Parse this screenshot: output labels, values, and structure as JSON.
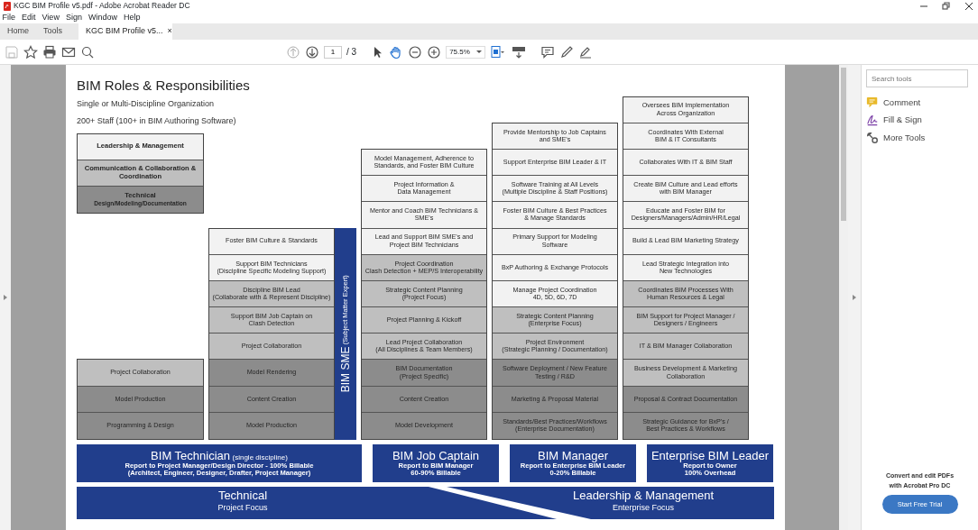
{
  "window": {
    "title": "KGC BIM Profile v5.pdf - Adobe Acrobat Reader DC"
  },
  "menu": [
    "File",
    "Edit",
    "View",
    "Sign",
    "Window",
    "Help"
  ],
  "tabs": [
    {
      "label": "Home",
      "selected": false
    },
    {
      "label": "Tools",
      "selected": false
    },
    {
      "label": "KGC BIM Profile v5...",
      "selected": true,
      "close": "×"
    }
  ],
  "toolbar": {
    "page": "1",
    "page_count": "/ 3",
    "zoom": "75.5%"
  },
  "document": {
    "title": "BIM Roles & Responsibilities",
    "subtitle": "Single or Multi-Discipline Organization",
    "staff": "200+ Staff (100+ in BIM Authoring Software)",
    "legend": [
      {
        "text": "Leadership & Management",
        "color": "#f2f2f2"
      },
      {
        "text": "Communication & Collaboration &\nCoordination",
        "color": "#bfbfbf"
      },
      {
        "text": "Technical",
        "note": "Design/Modeling/Documentation",
        "color": "#8c8c8c"
      }
    ],
    "columns": [
      {
        "rows": [
          {
            "text": "Project Collaboration",
            "color": "#bfbfbf"
          },
          {
            "text": "Model Production",
            "color": "#8c8c8c"
          },
          {
            "text": "Programming & Design",
            "color": "#8c8c8c"
          }
        ]
      },
      {
        "sme": {
          "title": "BIM SME",
          "note": "(Subject Matter Expert)"
        },
        "rows": [
          {
            "text": "Foster BIM Culture & Standards",
            "color": "#f2f2f2"
          },
          {
            "text": "Support BIM Technicians\n(Discipline Specific Modeling Support)",
            "color": "#f2f2f2"
          },
          {
            "text": "Discipline BIM Lead\n(Collaborate with & Represent Discipline)",
            "color": "#bfbfbf"
          },
          {
            "text": "Support BIM Job Captain on\nClash Detection",
            "color": "#bfbfbf"
          },
          {
            "text": "Project Collaboration",
            "color": "#bfbfbf"
          },
          {
            "text": "Model Rendering",
            "color": "#8c8c8c"
          },
          {
            "text": "Content Creation",
            "color": "#8c8c8c"
          },
          {
            "text": "Model Production",
            "color": "#8c8c8c"
          }
        ]
      },
      {
        "rows": [
          {
            "text": "Model Management, Adherence to\nStandards, and Foster BIM Culture",
            "color": "#f2f2f2"
          },
          {
            "text": "Project Information &\nData Management",
            "color": "#f2f2f2"
          },
          {
            "text": "Mentor and Coach BIM Technicians &\nSME's",
            "color": "#f2f2f2"
          },
          {
            "text": "Lead and Support BIM SME's and\nProject BIM Technicians",
            "color": "#f2f2f2"
          },
          {
            "text": "Project Coordination\nClash Detection + MEP/S Interoperability",
            "color": "#bfbfbf"
          },
          {
            "text": "Strategic Content Planning\n(Project Focus)",
            "color": "#bfbfbf"
          },
          {
            "text": "Project Planning & Kickoff",
            "color": "#bfbfbf"
          },
          {
            "text": "Lead Project Collaboration\n(All Disciplines & Team Members)",
            "color": "#bfbfbf"
          },
          {
            "text": "BIM Documentation\n(Project Specific)",
            "color": "#8c8c8c"
          },
          {
            "text": "Content Creation",
            "color": "#8c8c8c"
          },
          {
            "text": "Model Development",
            "color": "#8c8c8c"
          }
        ]
      },
      {
        "rows": [
          {
            "text": "Provide Mentorship to Job Captains\nand SME's",
            "color": "#f2f2f2"
          },
          {
            "text": "Support Enterprise BIM Leader & IT",
            "color": "#f2f2f2"
          },
          {
            "text": "Software Training at All Levels\n(Multiple Discipline & Staff Positions)",
            "color": "#f2f2f2"
          },
          {
            "text": "Foster BIM Culture & Best Practices\n& Manage Standards",
            "color": "#f2f2f2"
          },
          {
            "text": "Primary Support for Modeling\nSoftware",
            "color": "#f2f2f2"
          },
          {
            "text": "BxP Authoring & Exchange Protocols",
            "color": "#f2f2f2"
          },
          {
            "text": "Manage Project Coordination\n4D, 5D, 6D, 7D",
            "color": "#f2f2f2"
          },
          {
            "text": "Strategic Content Planning\n(Enterprise Focus)",
            "color": "#bfbfbf"
          },
          {
            "text": "Project Environment\n(Strategic Planning / Documentation)",
            "color": "#bfbfbf"
          },
          {
            "text": "Software Deployment / New Feature\nTesting / R&D",
            "color": "#8c8c8c"
          },
          {
            "text": "Marketing & Proposal Material",
            "color": "#8c8c8c"
          },
          {
            "text": "Standards/Best Practices/Workflows\n(Enterprise Documentation)",
            "color": "#8c8c8c"
          }
        ]
      },
      {
        "rows": [
          {
            "text": "Oversees BIM Implementation\nAcross Organization",
            "color": "#f2f2f2"
          },
          {
            "text": "Coordinates With External\nBIM & IT Consultants",
            "color": "#f2f2f2"
          },
          {
            "text": "Collaborates With  IT & BIM Staff",
            "color": "#f2f2f2"
          },
          {
            "text": "Create BIM Culture and Lead efforts\nwith BIM Manager",
            "color": "#f2f2f2"
          },
          {
            "text": "Educate and Foster BIM for\nDesigners/Managers/Admin/HR/Legal",
            "color": "#f2f2f2"
          },
          {
            "text": "Build & Lead BIM Marketing Strategy",
            "color": "#f2f2f2"
          },
          {
            "text": "Lead Strategic Integration into\nNew Technologies",
            "color": "#f2f2f2"
          },
          {
            "text": "Coordinates BIM Processes With\nHuman Resources & Legal",
            "color": "#bfbfbf"
          },
          {
            "text": "BIM Support for Project Manager /\nDesigners / Engineers",
            "color": "#bfbfbf"
          },
          {
            "text": "IT & BIM Manager Collaboration",
            "color": "#bfbfbf"
          },
          {
            "text": "Business Development & Marketing\nCollaboration",
            "color": "#bfbfbf"
          },
          {
            "text": "Proposal & Contract Documentation",
            "color": "#8c8c8c"
          },
          {
            "text": "Strategic Guidance for BxP's /\nBest Practices & Workflows",
            "color": "#8c8c8c"
          }
        ]
      }
    ],
    "roles": [
      {
        "title": "BIM Technician",
        "note": "(single discipline)",
        "lines": [
          "Report to Project Manager/Design Director - 100% Billable",
          "(Architect, Engineer, Designer, Drafter, Project Manager)"
        ]
      },
      {
        "title": "BIM Job Captain",
        "lines": [
          "Report to BIM Manager",
          "60-90% Billable"
        ]
      },
      {
        "title": "BIM Manager",
        "lines": [
          "Report to Enterprise BIM Leader",
          "0-20% Billable"
        ]
      },
      {
        "title": "Enterprise BIM Leader",
        "lines": [
          "Report to Owner",
          "100% Overhead"
        ]
      }
    ],
    "focus": [
      {
        "title": "Technical",
        "note": "Project Focus"
      },
      {
        "title": "Leadership & Management",
        "note": "Enterprise Focus"
      }
    ]
  },
  "tools_panel": {
    "search_placeholder": "Search tools",
    "tools": [
      {
        "label": "Comment",
        "kind": "comment"
      },
      {
        "label": "Fill & Sign",
        "kind": "sign"
      },
      {
        "label": "More Tools",
        "kind": "more"
      }
    ],
    "promo": "Convert and edit PDFs\nwith Acrobat Pro DC",
    "button": "Start Free Trial"
  }
}
